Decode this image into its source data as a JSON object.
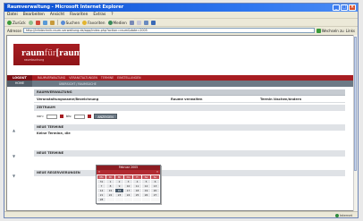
{
  "browser": {
    "title": "Raumverwaltung - Microsoft Internet Explorer",
    "menu": [
      "Datei",
      "Bearbeiten",
      "Ansicht",
      "Favoriten",
      "Extras",
      "?"
    ],
    "toolbar": {
      "back_label": "Zurück",
      "search_label": "Suchen",
      "favorites_label": "Favoriten",
      "media_label": "Medien"
    },
    "address": {
      "label": "Adresse",
      "url": "http://infotechnik.raum-verwaltung.de/app/index.php?action=raum&date=2005",
      "go_label": "Wechseln zu",
      "links_label": "Links"
    },
    "status": {
      "left": "",
      "zone": "Internet"
    }
  },
  "site": {
    "logo": {
      "part1": "raum",
      "part2": "für",
      "part3": "[raum",
      "suffix": "]",
      "tagline": "raumbuchung"
    },
    "redbar": {
      "brand": "LOGOUT",
      "nav": [
        "RAUMVERWALTUNG",
        "VERANSTALTUNGEN",
        "TERMINE",
        "EINSTELLUNGEN"
      ]
    },
    "graybar": {
      "home": "HOME",
      "breadcrumb": "ÜBERSICHT / RAUMSUCHE"
    }
  },
  "main": {
    "section_title": "RAUMVERWALTUNG",
    "columns": [
      "Veranstaltungsname/Bezeichnung",
      "Raume verwalten",
      "Termin löschen/ändern"
    ],
    "filter_title": "ZEITRAUM",
    "filter": {
      "from_label": "von:",
      "to_label": "bis:",
      "from_value": "",
      "to_value": "",
      "button": "ANZEIGEN"
    },
    "blocks": [
      {
        "arrow": "▲",
        "title": "NEUE TERMINE",
        "line": "Keine Termine, die"
      },
      {
        "arrow": "▼",
        "title": "NEUE TERMINE",
        "line": ""
      },
      {
        "arrow": "▼",
        "title": "NEUE RESERVIERUNGEN",
        "line": ""
      }
    ]
  },
  "calendar": {
    "title": "Februar 2005",
    "prev": "«",
    "next": "»",
    "days": [
      "Mo",
      "Di",
      "Mi",
      "Do",
      "Fr",
      "Sa",
      "So"
    ],
    "weeks": [
      [
        "31",
        "1",
        "2",
        "3",
        "4",
        "5",
        "6"
      ],
      [
        "7",
        "8",
        "9",
        "10",
        "11",
        "12",
        "13"
      ],
      [
        "14",
        "15",
        "16",
        "17",
        "18",
        "19",
        "20"
      ],
      [
        "21",
        "22",
        "23",
        "24",
        "25",
        "26",
        "27"
      ],
      [
        "28",
        "",
        "",
        "",
        "",
        "",
        ""
      ]
    ],
    "selected": "16"
  },
  "colors": {
    "brand_red": "#a71d22",
    "nav_gray": "#6d7a86",
    "xp_blue": "#0b4fd1"
  }
}
